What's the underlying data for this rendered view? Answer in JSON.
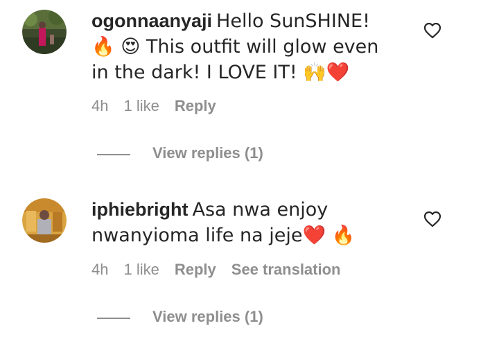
{
  "comments": [
    {
      "username": "ogonnaanyaji",
      "text": "Hello SunSHINE! 🔥 😍 This outfit will glow even in the dark! I LOVE IT! 🙌❤️",
      "time": "4h",
      "likes": "1 like",
      "reply_label": "Reply",
      "translation_label": "",
      "view_replies": "View replies (1)",
      "avatar_icon": "avatar-photo-icon",
      "like_icon": "heart-outline-icon"
    },
    {
      "username": "iphiebright",
      "text": "Asa nwa enjoy nwanyioma life na jeje❤️ 🔥",
      "time": "4h",
      "likes": "1 like",
      "reply_label": "Reply",
      "translation_label": "See translation",
      "view_replies": "View replies (1)",
      "avatar_icon": "avatar-photo-icon",
      "like_icon": "heart-outline-icon"
    }
  ],
  "colors": {
    "text": "#262626",
    "secondary": "#8e8e8e",
    "background": "#ffffff"
  }
}
